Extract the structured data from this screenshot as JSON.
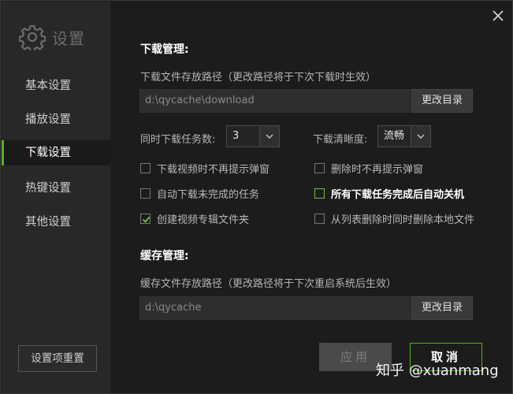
{
  "app": {
    "title": "设置"
  },
  "sidebar": {
    "items": [
      {
        "label": "基本设置"
      },
      {
        "label": "播放设置"
      },
      {
        "label": "下载设置"
      },
      {
        "label": "热键设置"
      },
      {
        "label": "其他设置"
      }
    ],
    "active_index": 2,
    "reset_label": "设置项重置"
  },
  "download": {
    "title": "下载管理:",
    "path_label": "下载文件存放路径（更改路径将于下次下载时生效）",
    "path_value": "d:\\qycache\\download",
    "change_label": "更改目录",
    "tasks_label": "同时下载任务数:",
    "tasks_value": "3",
    "quality_label": "下载清晰度:",
    "quality_value": "流畅",
    "options": [
      {
        "label": "下载视频时不再提示弹窗",
        "checked": false
      },
      {
        "label": "删除时不再提示弹窗",
        "checked": false
      },
      {
        "label": "自动下载未完成的任务",
        "checked": false
      },
      {
        "label": "所有下载任务完成后自动关机",
        "checked": false
      },
      {
        "label": "创建视频专辑文件夹",
        "checked": true
      },
      {
        "label": "从列表删除时同时删除本地文件",
        "checked": false
      }
    ]
  },
  "cache": {
    "title": "缓存管理:",
    "path_label": "缓存文件存放路径（更改路径将于下次重启系统后生效）",
    "path_value": "d:\\qycache",
    "change_label": "更改目录"
  },
  "footer": {
    "apply_label": "应用",
    "cancel_label": "取消"
  },
  "watermark": "知乎 @xuanmang",
  "colors": {
    "accent": "#57b319",
    "background": "#1c1c1c",
    "sidebar": "#282828"
  }
}
